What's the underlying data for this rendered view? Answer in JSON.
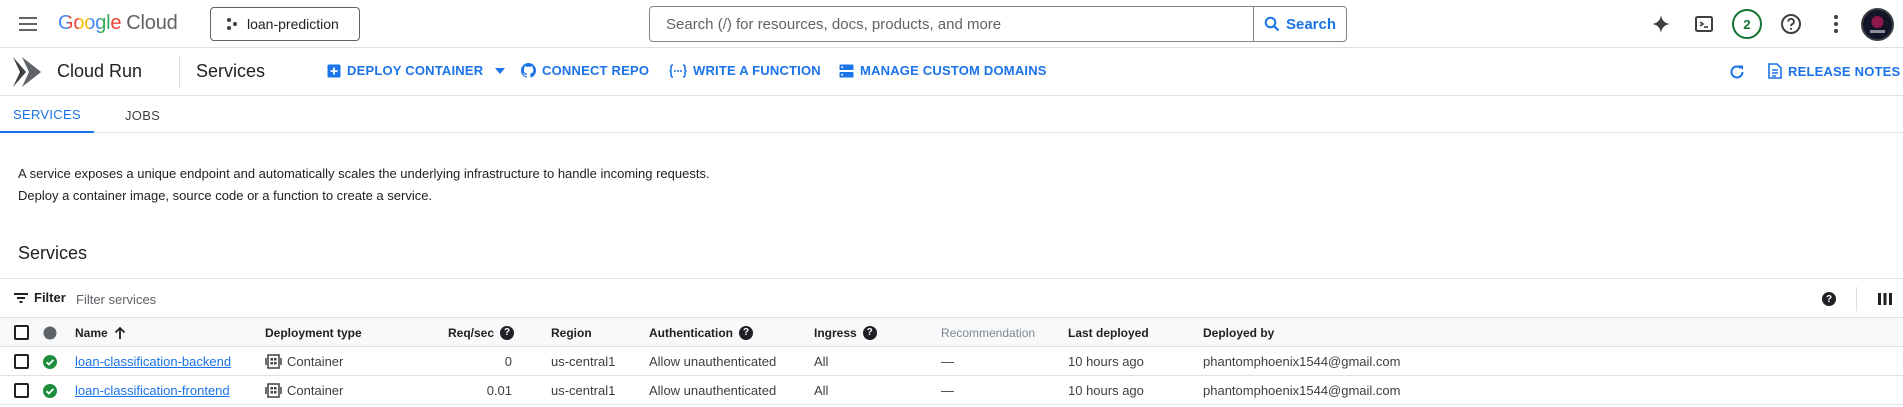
{
  "topbar": {
    "logo_google": "Google",
    "logo_cloud": "Cloud",
    "project": "loan-prediction",
    "search_placeholder": "Search (/) for resources, docs, products, and more",
    "search_button": "Search",
    "notification_count": "2"
  },
  "product": {
    "name": "Cloud Run",
    "page_title": "Services"
  },
  "actions": {
    "deploy": "DEPLOY CONTAINER",
    "connect": "CONNECT REPO",
    "function": "WRITE A FUNCTION",
    "domains": "MANAGE CUSTOM DOMAINS",
    "release_notes": "RELEASE NOTES"
  },
  "tabs": [
    "SERVICES",
    "JOBS"
  ],
  "description": [
    "A service exposes a unique endpoint and automatically scales the underlying infrastructure to handle incoming requests.",
    "Deploy a container image, source code or a function to create a service."
  ],
  "section_title": "Services",
  "filter": {
    "label": "Filter",
    "placeholder": "Filter services"
  },
  "table": {
    "headers": {
      "name": "Name",
      "deployment_type": "Deployment type",
      "req_sec": "Req/sec",
      "region": "Region",
      "authentication": "Authentication",
      "ingress": "Ingress",
      "recommendation": "Recommendation",
      "last_deployed": "Last deployed",
      "deployed_by": "Deployed by"
    },
    "rows": [
      {
        "name": "loan-classification-backend",
        "deployment_type": "Container",
        "req_sec": "0",
        "region": "us-central1",
        "authentication": "Allow unauthenticated",
        "ingress": "All",
        "recommendation": "—",
        "last_deployed": "10 hours ago",
        "deployed_by": "phantomphoenix1544@gmail.com"
      },
      {
        "name": "loan-classification-frontend",
        "deployment_type": "Container",
        "req_sec": "0.01",
        "region": "us-central1",
        "authentication": "Allow unauthenticated",
        "ingress": "All",
        "recommendation": "—",
        "last_deployed": "10 hours ago",
        "deployed_by": "phantomphoenix1544@gmail.com"
      }
    ]
  },
  "colors": {
    "accent": "#1a73e8",
    "success": "#1e8e3e",
    "text": "#202124"
  }
}
